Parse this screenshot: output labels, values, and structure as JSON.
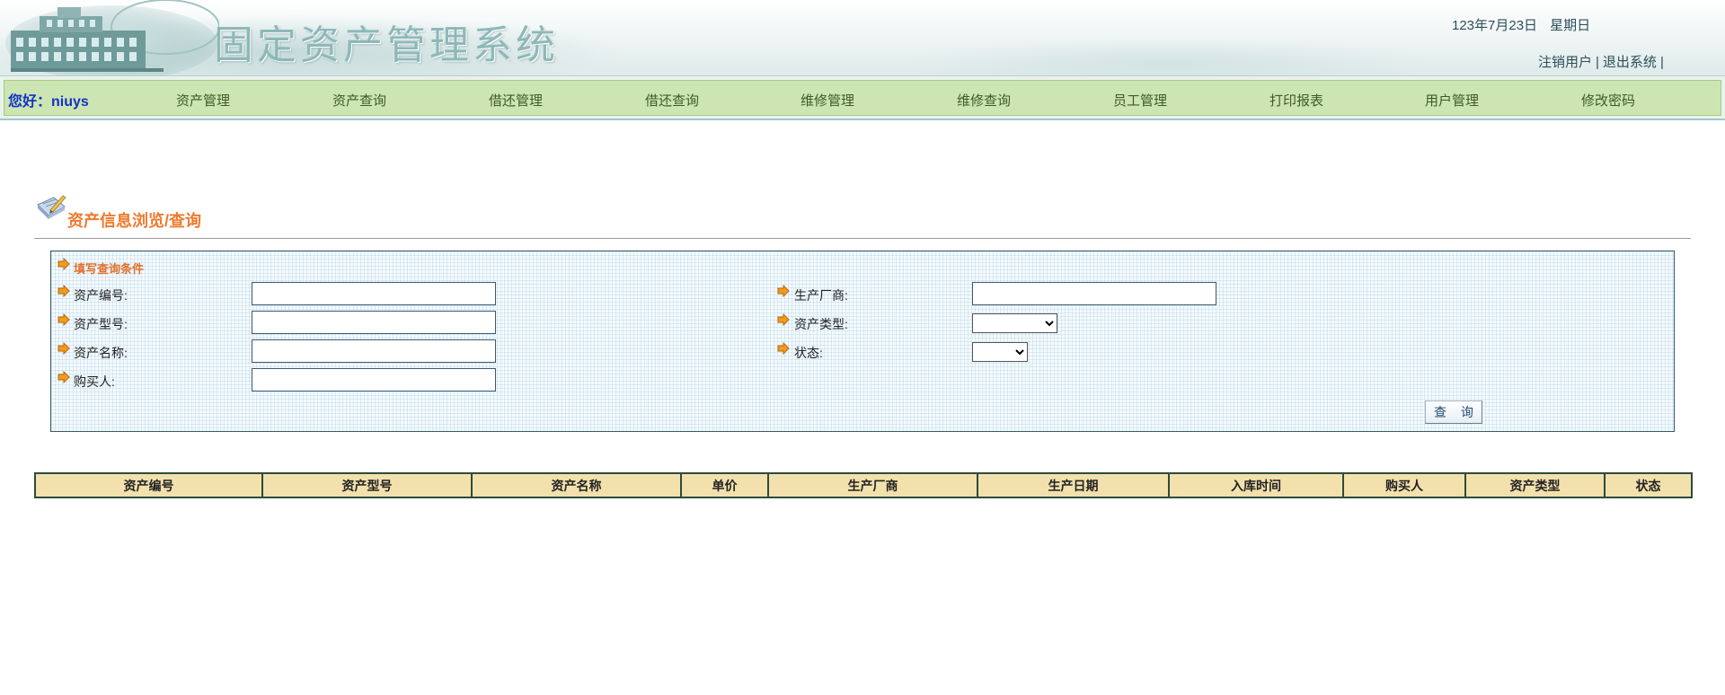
{
  "header": {
    "title": "固定资产管理系统",
    "date": "123年7月23日",
    "weekday": "星期日",
    "logout_user": "注销用户",
    "exit_system": "退出系统",
    "separator": "|"
  },
  "nav": {
    "greeting": "您好：niuys",
    "items": [
      {
        "label": "资产管理"
      },
      {
        "label": "资产查询"
      },
      {
        "label": "借还管理"
      },
      {
        "label": "借还查询"
      },
      {
        "label": "维修管理"
      },
      {
        "label": "维修查询"
      },
      {
        "label": "员工管理"
      },
      {
        "label": "打印报表"
      },
      {
        "label": "用户管理"
      },
      {
        "label": "修改密码"
      }
    ]
  },
  "section": {
    "title": "资产信息浏览/查询"
  },
  "query": {
    "caption": "填写查询条件",
    "asset_no_label": "资产编号:",
    "asset_no_value": "",
    "model_label": "资产型号:",
    "model_value": "",
    "name_label": "资产名称:",
    "name_value": "",
    "buyer_label": "购买人:",
    "buyer_value": "",
    "maker_label": "生产厂商:",
    "maker_value": "",
    "type_label": "资产类型:",
    "type_selected": "",
    "status_label": "状态:",
    "status_selected": "",
    "button_label": "查 询"
  },
  "table": {
    "columns": [
      "资产编号",
      "资产型号",
      "资产名称",
      "单价",
      "生产厂商",
      "生产日期",
      "入库时间",
      "购买人",
      "资产类型",
      "状态"
    ],
    "rows": []
  },
  "colors": {
    "nav_bg": "#cde5b3",
    "greeting": "#1234c4",
    "accent_orange": "#ef7a2f",
    "table_header_bg": "#f2e1ad"
  },
  "icons": {
    "logo": "building-logo-icon",
    "section": "notebook-pen-icon",
    "bullet": "orange-arrow-icon"
  }
}
